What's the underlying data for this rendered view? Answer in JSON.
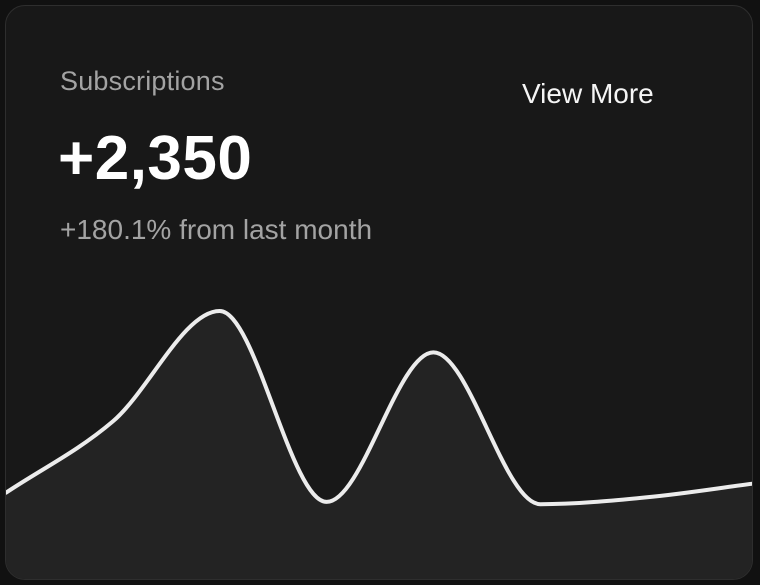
{
  "card": {
    "title": "Subscriptions",
    "value": "+2,350",
    "change": "+180.1% from last month",
    "view_more_label": "View More"
  },
  "colors": {
    "card_background": "#181818",
    "area_fill": "#232323",
    "line_stroke": "#ececec",
    "muted_text": "#a3a3a3",
    "primary_text": "#ffffff"
  },
  "chart_data": {
    "type": "area",
    "x": [
      0,
      1,
      2,
      3,
      4,
      5,
      6,
      7
    ],
    "values": [
      0.21,
      0.52,
      1.0,
      0.17,
      0.82,
      0.16,
      0.19,
      0.25
    ],
    "ylim": [
      0,
      1
    ],
    "grid": false,
    "axes_visible": false,
    "legend": "none"
  }
}
